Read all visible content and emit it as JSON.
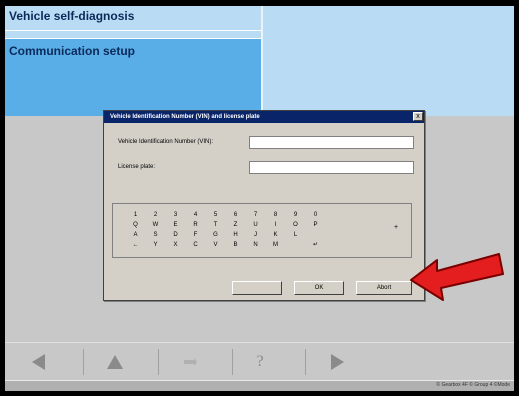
{
  "header": {
    "title": "Vehicle self-diagnosis",
    "section": "Communication setup"
  },
  "dialog": {
    "title": "Vehicle Identification Number (VIN) and license plate",
    "close_label": "x",
    "vin_label": "Vehicle Identification Number (VIN):",
    "vin_value": "",
    "plate_label": "License plate:",
    "plate_value": "",
    "keyboard": {
      "rows": [
        [
          "1",
          "2",
          "3",
          "4",
          "5",
          "6",
          "7",
          "8",
          "9",
          "0"
        ],
        [
          "Q",
          "W",
          "E",
          "R",
          "T",
          "Z",
          "U",
          "I",
          "O",
          "P"
        ],
        [
          "A",
          "S",
          "D",
          "F",
          "G",
          "H",
          "J",
          "K",
          "L",
          ""
        ],
        [
          "←",
          "Y",
          "X",
          "C",
          "V",
          "B",
          "N",
          "M",
          "",
          "↵"
        ]
      ],
      "extra_key": "+"
    },
    "buttons": {
      "disabled_label": "",
      "ok_label": "OK",
      "abort_label": "Abort"
    }
  },
  "toolbar": {
    "icons": [
      "back-arrow-icon",
      "home-triangle-icon",
      "tools-icon",
      "help-icon",
      "forward-arrow-icon"
    ],
    "help_label": "?"
  },
  "status": {
    "text": "© Gearbox 4F  © Group 4  ©Mode"
  },
  "colors": {
    "header_bg": "#b9dcf4",
    "selected_bg": "#5aaee8",
    "dialog_title_bg": "#0a246a",
    "arrow": "#e41e1e"
  }
}
